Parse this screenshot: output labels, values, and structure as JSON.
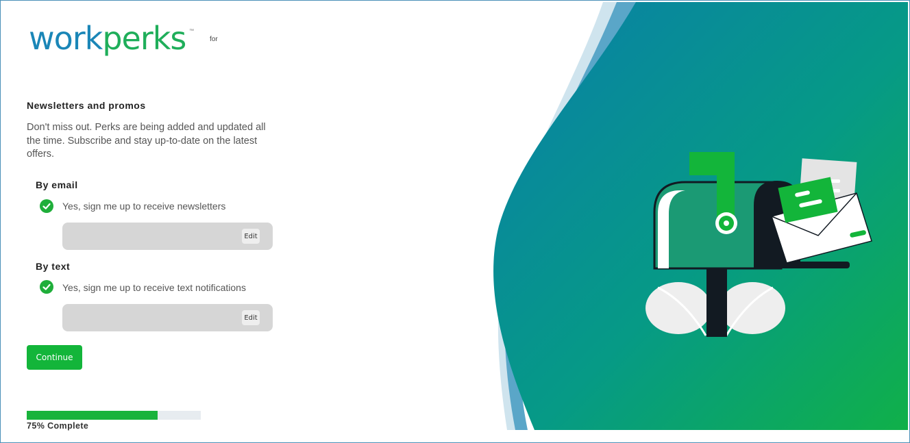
{
  "brand": {
    "logo_work": "work",
    "logo_perks": "perks",
    "trademark": "™",
    "for_label": "for"
  },
  "main": {
    "title": "Newsletters and promos",
    "description": "Don't miss out. Perks are being added and updated all the time. Subscribe and stay up-to-date on the latest offers."
  },
  "email": {
    "heading": "By email",
    "checkbox_label": "Yes, sign me up to receive newsletters",
    "checked": true,
    "value": "",
    "edit_label": "Edit"
  },
  "text": {
    "heading": "By text",
    "checkbox_label": "Yes, sign me up to receive text notifications",
    "checked": true,
    "value": "",
    "edit_label": "Edit"
  },
  "actions": {
    "continue_label": "Continue"
  },
  "progress": {
    "percent": 75,
    "label": "75% Complete"
  },
  "colors": {
    "accent_green": "#13b53a",
    "brand_blue": "#1a86b7",
    "gradient_start": "#0a7fa8",
    "gradient_end": "#10b049"
  },
  "illustration": {
    "icon": "mailbox-with-envelope-icon"
  }
}
